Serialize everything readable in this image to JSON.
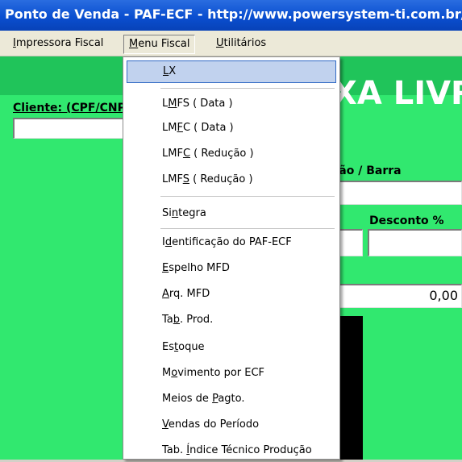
{
  "window": {
    "title": "Ponto de Venda - PAF-ECF - http://www.powersystem-ti.com.br/"
  },
  "menubar": [
    {
      "pre": "",
      "acc": "I",
      "post": "mpressora Fiscal"
    },
    {
      "pre": "",
      "acc": "M",
      "post": "enu Fiscal"
    },
    {
      "pre": "",
      "acc": "U",
      "post": "tilitários"
    }
  ],
  "background": {
    "banner_text": "XA LIVR",
    "cliente_label": "Cliente: (CPF/CNPJ",
    "codigo_label": "ção / Barra",
    "desconto_label": "Desconto %",
    "total_value": "0,00"
  },
  "colors": {
    "client_green": "#31e86f",
    "banner_green": "#20c45a",
    "titlebar_blue": "#0a4fd0",
    "menu_highlight": "#c1d2ee"
  },
  "dropdown": [
    {
      "pre": "",
      "acc": "L",
      "post": "X"
    },
    {
      "pre": "L",
      "acc": "M",
      "post": "FS ( Data )"
    },
    {
      "pre": "LM",
      "acc": "F",
      "post": "C ( Data )"
    },
    {
      "pre": "LMF",
      "acc": "C",
      "post": " ( Redução )"
    },
    {
      "pre": "LMF",
      "acc": "S",
      "post": " ( Redução )"
    },
    {
      "pre": "Si",
      "acc": "n",
      "post": "tegra"
    },
    {
      "pre": "I",
      "acc": "d",
      "post": "entificação do PAF-ECF"
    },
    {
      "pre": "",
      "acc": "E",
      "post": "spelho MFD"
    },
    {
      "pre": "",
      "acc": "A",
      "post": "rq. MFD"
    },
    {
      "pre": "Ta",
      "acc": "b",
      "post": ". Prod."
    },
    {
      "pre": "Es",
      "acc": "t",
      "post": "oque"
    },
    {
      "pre": "M",
      "acc": "o",
      "post": "vimento por ECF"
    },
    {
      "pre": "Meios de ",
      "acc": "P",
      "post": "agto."
    },
    {
      "pre": "",
      "acc": "V",
      "post": "endas do Período"
    },
    {
      "pre": "Tab. ",
      "acc": "Í",
      "post": "ndice Técnico Produção"
    }
  ]
}
